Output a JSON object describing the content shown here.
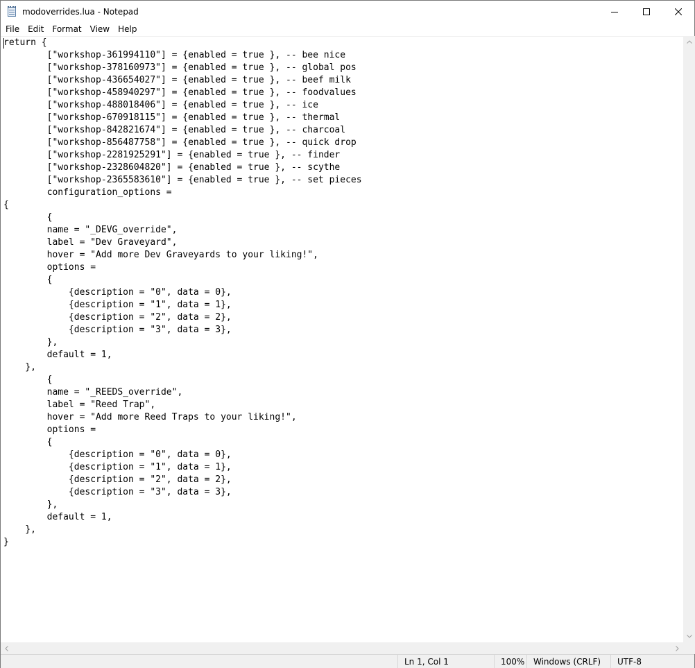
{
  "window": {
    "title": "modoverrides.lua - Notepad"
  },
  "menu": {
    "items": [
      "File",
      "Edit",
      "Format",
      "View",
      "Help"
    ]
  },
  "editor": {
    "lines": [
      "return {",
      "        [\"workshop-361994110\"] = {enabled = true }, -- bee nice",
      "        [\"workshop-378160973\"] = {enabled = true }, -- global pos",
      "        [\"workshop-436654027\"] = {enabled = true }, -- beef milk",
      "        [\"workshop-458940297\"] = {enabled = true }, -- foodvalues",
      "        [\"workshop-488018406\"] = {enabled = true }, -- ice",
      "        [\"workshop-670918115\"] = {enabled = true }, -- thermal",
      "        [\"workshop-842821674\"] = {enabled = true }, -- charcoal",
      "        [\"workshop-856487758\"] = {enabled = true }, -- quick drop",
      "        [\"workshop-2281925291\"] = {enabled = true }, -- finder",
      "        [\"workshop-2328604820\"] = {enabled = true }, -- scythe",
      "        [\"workshop-2365583610\"] = {enabled = true }, -- set pieces",
      "        configuration_options =",
      "{",
      "        {",
      "        name = \"_DEVG_override\",",
      "        label = \"Dev Graveyard\",",
      "        hover = \"Add more Dev Graveyards to your liking!\",",
      "        options =",
      "        {",
      "            {description = \"0\", data = 0},",
      "            {description = \"1\", data = 1},",
      "            {description = \"2\", data = 2},",
      "            {description = \"3\", data = 3},",
      "        },",
      "        default = 1,",
      "    },",
      "        {",
      "        name = \"_REEDS_override\",",
      "        label = \"Reed Trap\",",
      "        hover = \"Add more Reed Traps to your liking!\",",
      "        options =",
      "        {",
      "            {description = \"0\", data = 0},",
      "            {description = \"1\", data = 1},",
      "            {description = \"2\", data = 2},",
      "            {description = \"3\", data = 3},",
      "        },",
      "        default = 1,",
      "    },",
      "}"
    ]
  },
  "status": {
    "position": "Ln 1, Col 1",
    "zoom": "100%",
    "line_ending": "Windows (CRLF)",
    "encoding": "UTF-8"
  },
  "icons": {
    "app": "notepad-icon",
    "minimize": "minimize-icon",
    "maximize": "maximize-icon",
    "close": "close-icon"
  }
}
